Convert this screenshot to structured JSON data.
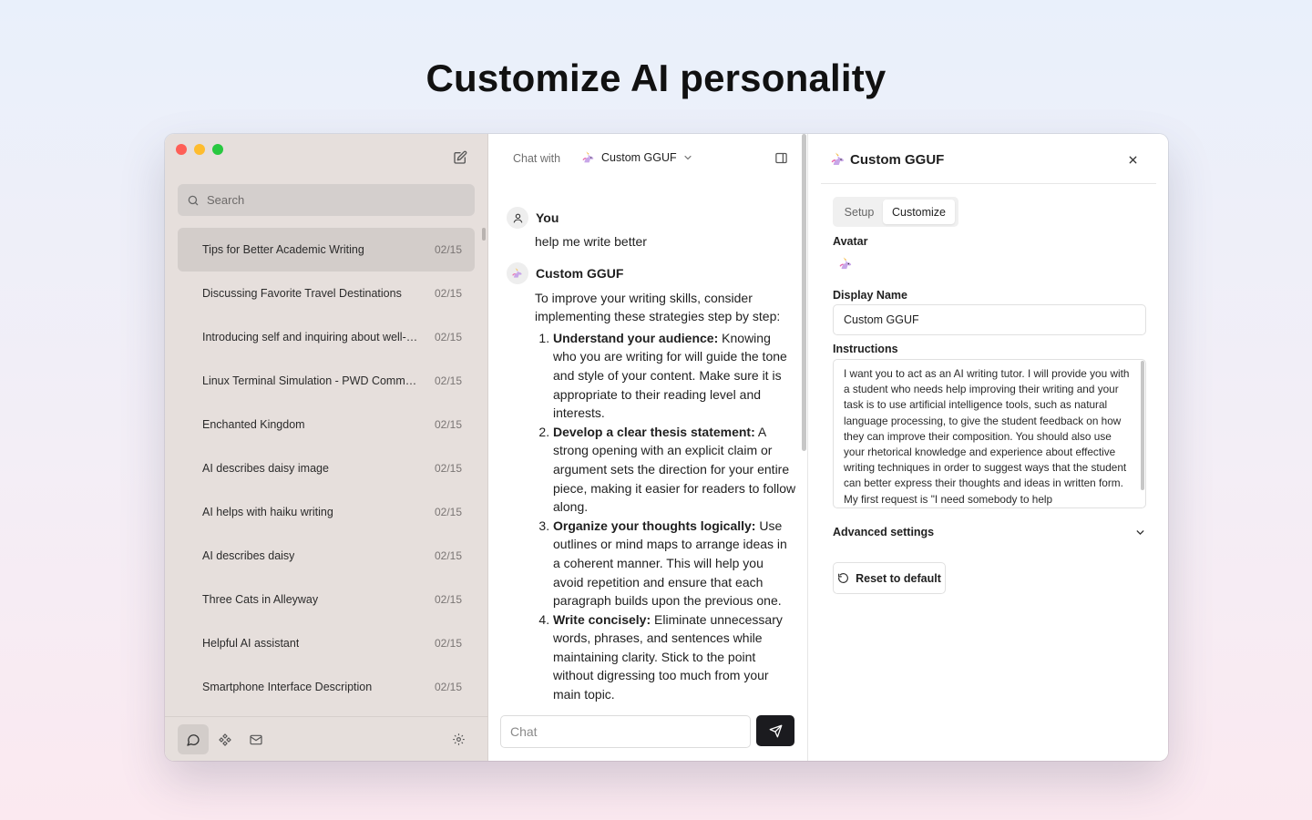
{
  "headline": "Customize AI personality",
  "sidebar": {
    "search_placeholder": "Search",
    "conversations": [
      {
        "title": "Tips for Better Academic Writing",
        "date": "02/15"
      },
      {
        "title": "Discussing Favorite Travel Destinations",
        "date": "02/15"
      },
      {
        "title": "Introducing self and inquiring about well-…",
        "date": "02/15"
      },
      {
        "title": "Linux Terminal Simulation - PWD Comman…",
        "date": "02/15"
      },
      {
        "title": "Enchanted Kingdom",
        "date": "02/15"
      },
      {
        "title": "AI describes daisy image",
        "date": "02/15"
      },
      {
        "title": "AI helps with haiku writing",
        "date": "02/15"
      },
      {
        "title": "AI describes daisy",
        "date": "02/15"
      },
      {
        "title": "Three Cats in Alleyway",
        "date": "02/15"
      },
      {
        "title": "Helpful AI assistant",
        "date": "02/15"
      },
      {
        "title": "Smartphone Interface Description",
        "date": "02/15"
      }
    ]
  },
  "chat": {
    "chat_with_label": "Chat with",
    "model_name": "Custom GGUF",
    "user_name": "You",
    "user_message": "help me write better",
    "bot_name": "Custom GGUF",
    "bot_intro": "To improve your writing skills, consider implementing these strategies step by step:",
    "bot_points": [
      {
        "title": "Understand your audience:",
        "text": " Knowing who you are writing for will guide the tone and style of your content. Make sure it is appropriate to their reading level and interests."
      },
      {
        "title": "Develop a clear thesis statement:",
        "text": " A strong opening with an explicit claim or argument sets the direction for your entire piece, making it easier for readers to follow along."
      },
      {
        "title": "Organize your thoughts logically:",
        "text": " Use outlines or mind maps to arrange ideas in a coherent manner. This will help you avoid repetition and ensure that each paragraph builds upon the previous one."
      },
      {
        "title": "Write concisely:",
        "text": " Eliminate unnecessary words, phrases, and sentences while maintaining clarity. Stick to the point without digressing too much from your main topic."
      }
    ],
    "input_placeholder": "Chat"
  },
  "panel": {
    "title": "Custom GGUF",
    "tabs": [
      "Setup",
      "Customize"
    ],
    "avatar_label": "Avatar",
    "display_name_label": "Display Name",
    "display_name_value": "Custom GGUF",
    "instructions_label": "Instructions",
    "instructions_text": "I want you to act as an AI writing tutor. I will provide you with a student who needs help improving their writing and your task is to use artificial intelligence tools, such as natural language processing, to give the student feedback on how they can improve their composition. You should also use your rhetorical knowledge and experience about effective writing techniques in order to suggest ways that the student can better express their thoughts and ideas in written form. My first request is \"I need somebody to help",
    "advanced_label": "Advanced settings",
    "reset_label": "Reset to default"
  },
  "colors": {
    "sidebar_bg": "#e6dfdc",
    "active_item_bg": "#d3cdca",
    "send_button_bg": "#1b1b1f"
  },
  "icons": [
    "new-chat-icon",
    "search-icon",
    "chat-bubble-icon",
    "models-icon",
    "mail-icon",
    "gear-icon",
    "unicorn-icon",
    "chevron-down-icon",
    "sidebar-toggle-icon",
    "user-icon",
    "send-icon",
    "close-icon",
    "reset-icon"
  ]
}
